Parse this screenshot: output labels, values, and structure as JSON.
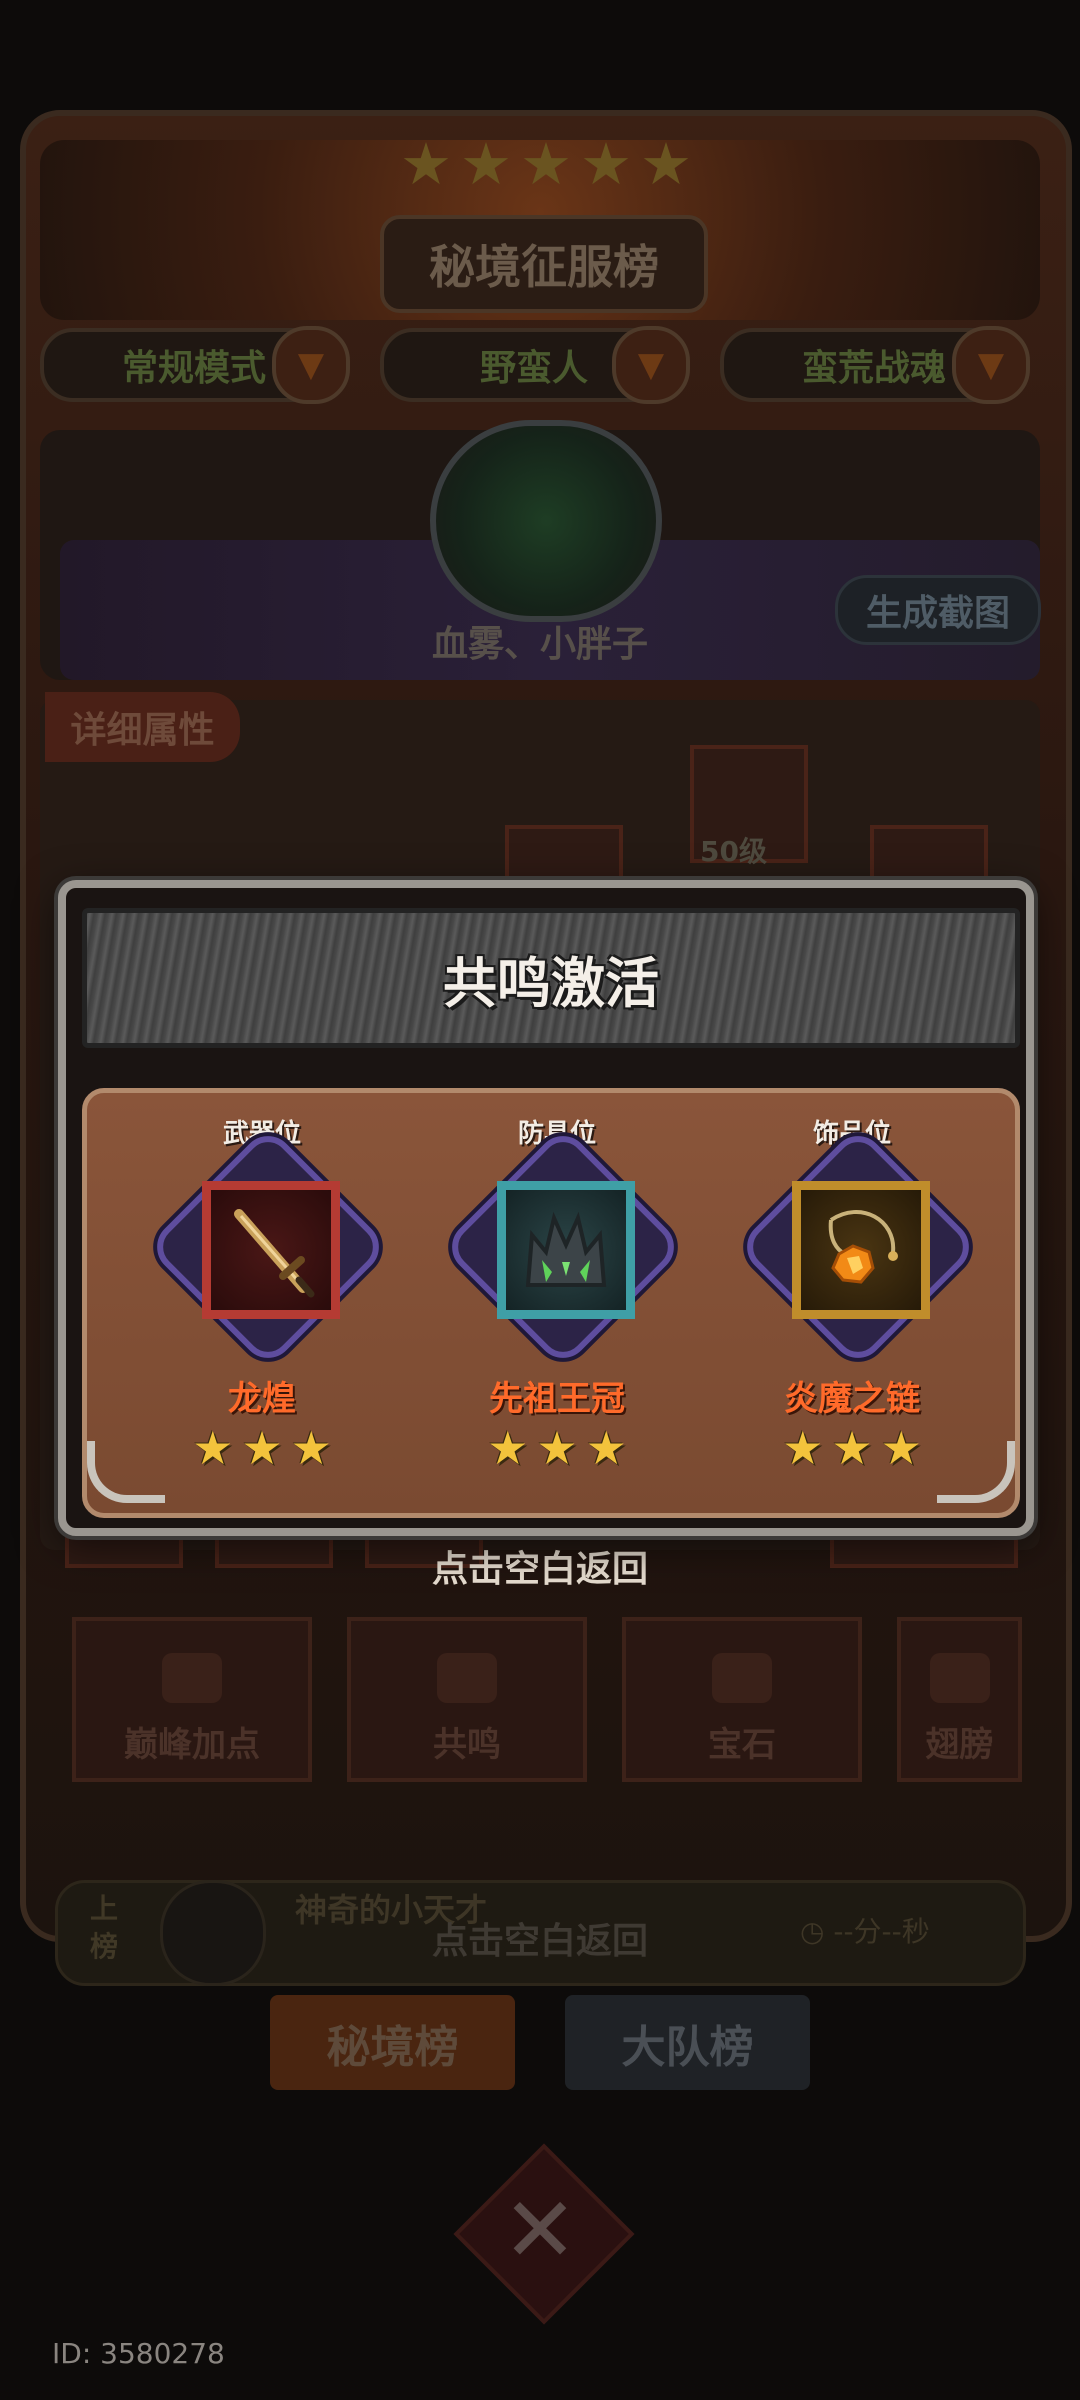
{
  "background": {
    "title": "秘境征服榜",
    "dropdowns": [
      "常规模式",
      "野蛮人",
      "蛮荒战魂"
    ],
    "player_names": "血雾、小胖子",
    "screenshot_button": "生成截图",
    "detail_tab": "详细属性",
    "equip_level": "50级",
    "function_buttons": [
      "巅峰加点",
      "共鸣",
      "宝石",
      "翅膀"
    ],
    "rank_bar": {
      "label": "上榜",
      "player_name": "神奇的小天才",
      "time": "--分--秒"
    },
    "back_hint_low": "点击空白返回",
    "tabs": {
      "secret_rank": "秘境榜",
      "team_rank": "大队榜"
    }
  },
  "modal": {
    "title": "共鸣激活",
    "slots": [
      {
        "label": "武器位",
        "item_name": "龙煌",
        "stars": 3,
        "icon": "sword-icon"
      },
      {
        "label": "防具位",
        "item_name": "先祖王冠",
        "stars": 3,
        "icon": "crown-icon"
      },
      {
        "label": "饰品位",
        "item_name": "炎魔之链",
        "stars": 3,
        "icon": "amulet-icon"
      }
    ]
  },
  "back_hint": "点击空白返回",
  "user_id": "ID: 3580278",
  "colors": {
    "item_name": "#ff6a2a",
    "star": "#f3c33c",
    "modal_body": "#7a4a31"
  }
}
